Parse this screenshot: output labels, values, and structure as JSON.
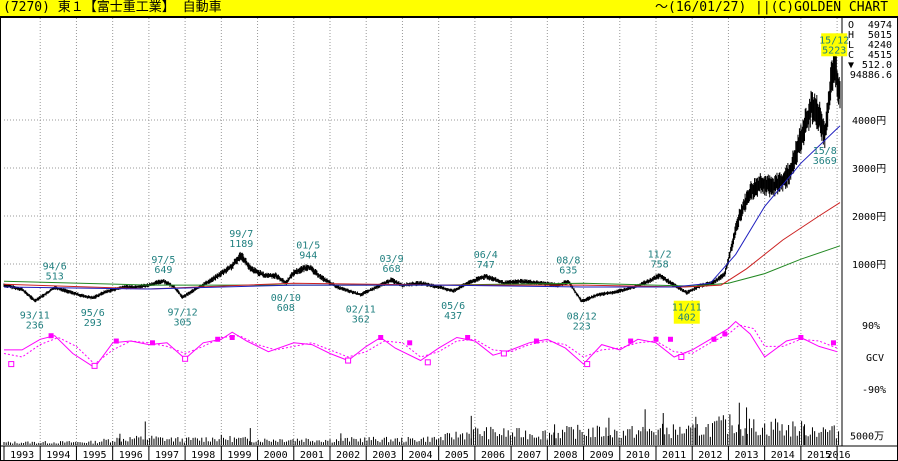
{
  "header": {
    "title": "(7270) 東１【富士重工業】 自動車",
    "date_range": "～(16/01/27)",
    "copyright": "||(C)GOLDEN CHART"
  },
  "colors": {
    "title_bg": "#ffff00",
    "candle": "#000000",
    "ma_short": "#1f1fbf",
    "ma_mid": "#cc2222",
    "ma_long": "#228822",
    "annotation_text": "#1f7f7f",
    "gcv_line": "#ff00ff",
    "gcv_marker": "#ff00ff",
    "volume": "#000000",
    "grid": "#999999",
    "highlight": "#ffff00"
  },
  "chart_data": [
    {
      "type": "line",
      "name": "price",
      "x_start": 1993.0,
      "x_end": 2016.08,
      "ylim": [
        0,
        5500
      ],
      "unit": "円",
      "y_ticks": [
        {
          "value": 1000,
          "label": "1000円"
        },
        {
          "value": 2000,
          "label": "2000円"
        },
        {
          "value": 3000,
          "label": "3000円"
        },
        {
          "value": 4000,
          "label": "4000円"
        }
      ],
      "ohlc_box": [
        {
          "label": "O",
          "value": "4974"
        },
        {
          "label": "H",
          "value": "5015"
        },
        {
          "label": "L",
          "value": "4240"
        },
        {
          "label": "C",
          "value": "4515"
        },
        {
          "label": "▼",
          "value": "512.0"
        },
        {
          "label": "",
          "value": "94886.6"
        }
      ],
      "close_series": [
        [
          1993.0,
          560
        ],
        [
          1993.5,
          470
        ],
        [
          1993.85,
          236
        ],
        [
          1994.2,
          400
        ],
        [
          1994.4,
          513
        ],
        [
          1994.8,
          420
        ],
        [
          1995.2,
          330
        ],
        [
          1995.45,
          293
        ],
        [
          1995.8,
          420
        ],
        [
          1996.3,
          520
        ],
        [
          1996.6,
          520
        ],
        [
          1997.0,
          560
        ],
        [
          1997.4,
          649
        ],
        [
          1997.7,
          520
        ],
        [
          1997.93,
          305
        ],
        [
          1998.3,
          480
        ],
        [
          1998.8,
          700
        ],
        [
          1999.3,
          960
        ],
        [
          1999.55,
          1189
        ],
        [
          1999.8,
          900
        ],
        [
          2000.2,
          760
        ],
        [
          2000.5,
          760
        ],
        [
          2000.78,
          608
        ],
        [
          2001.0,
          820
        ],
        [
          2001.4,
          944
        ],
        [
          2001.8,
          700
        ],
        [
          2002.2,
          520
        ],
        [
          2002.5,
          440
        ],
        [
          2002.85,
          362
        ],
        [
          2003.3,
          520
        ],
        [
          2003.7,
          668
        ],
        [
          2004.0,
          560
        ],
        [
          2004.5,
          600
        ],
        [
          2005.0,
          520
        ],
        [
          2005.4,
          437
        ],
        [
          2005.8,
          600
        ],
        [
          2006.3,
          747
        ],
        [
          2006.8,
          600
        ],
        [
          2007.3,
          640
        ],
        [
          2007.8,
          600
        ],
        [
          2008.3,
          560
        ],
        [
          2008.58,
          635
        ],
        [
          2008.95,
          223
        ],
        [
          2009.4,
          360
        ],
        [
          2009.9,
          420
        ],
        [
          2010.4,
          520
        ],
        [
          2010.8,
          640
        ],
        [
          2011.1,
          758
        ],
        [
          2011.5,
          560
        ],
        [
          2011.85,
          402
        ],
        [
          2012.2,
          540
        ],
        [
          2012.6,
          620
        ],
        [
          2012.9,
          800
        ],
        [
          2013.1,
          1400
        ],
        [
          2013.3,
          2000
        ],
        [
          2013.6,
          2500
        ],
        [
          2013.9,
          2700
        ],
        [
          2014.2,
          2600
        ],
        [
          2014.5,
          2750
        ],
        [
          2014.7,
          2900
        ],
        [
          2014.95,
          3500
        ],
        [
          2015.3,
          4300
        ],
        [
          2015.5,
          4100
        ],
        [
          2015.66,
          3669
        ],
        [
          2015.8,
          4600
        ],
        [
          2015.92,
          5223
        ],
        [
          2016.08,
          4515
        ]
      ],
      "ma_short": [
        [
          1993.0,
          520
        ],
        [
          1997.0,
          480
        ],
        [
          2001.0,
          560
        ],
        [
          2005.0,
          560
        ],
        [
          2009.0,
          520
        ],
        [
          2011.5,
          520
        ],
        [
          2012.5,
          600
        ],
        [
          2013.2,
          1200
        ],
        [
          2014.0,
          2200
        ],
        [
          2015.0,
          3100
        ],
        [
          2016.08,
          3880
        ]
      ],
      "ma_mid": [
        [
          1993.0,
          580
        ],
        [
          1997.0,
          480
        ],
        [
          2001.0,
          600
        ],
        [
          2005.0,
          560
        ],
        [
          2009.0,
          560
        ],
        [
          2011.8,
          520
        ],
        [
          2012.8,
          560
        ],
        [
          2013.5,
          900
        ],
        [
          2014.5,
          1500
        ],
        [
          2015.5,
          2000
        ],
        [
          2016.08,
          2280
        ]
      ],
      "ma_long": [
        [
          1993.0,
          640
        ],
        [
          1997.0,
          560
        ],
        [
          2001.0,
          560
        ],
        [
          2005.0,
          560
        ],
        [
          2009.0,
          600
        ],
        [
          2012.0,
          540
        ],
        [
          2013.0,
          600
        ],
        [
          2014.0,
          800
        ],
        [
          2015.0,
          1100
        ],
        [
          2016.08,
          1380
        ]
      ],
      "annotations": [
        {
          "x": 1993.85,
          "y": 236,
          "period": "93/11",
          "value": "236",
          "pos": "below"
        },
        {
          "x": 1994.4,
          "y": 513,
          "period": "94/6",
          "value": "513",
          "pos": "above"
        },
        {
          "x": 1995.45,
          "y": 293,
          "period": "95/6",
          "value": "293",
          "pos": "below"
        },
        {
          "x": 1997.4,
          "y": 649,
          "period": "97/5",
          "value": "649",
          "pos": "above"
        },
        {
          "x": 1997.93,
          "y": 305,
          "period": "97/12",
          "value": "305",
          "pos": "below"
        },
        {
          "x": 1999.55,
          "y": 1189,
          "period": "99/7",
          "value": "1189",
          "pos": "above"
        },
        {
          "x": 2000.78,
          "y": 608,
          "period": "00/10",
          "value": "608",
          "pos": "below"
        },
        {
          "x": 2001.4,
          "y": 944,
          "period": "01/5",
          "value": "944",
          "pos": "above"
        },
        {
          "x": 2002.85,
          "y": 362,
          "period": "02/11",
          "value": "362",
          "pos": "below"
        },
        {
          "x": 2003.7,
          "y": 668,
          "period": "03/9",
          "value": "668",
          "pos": "above"
        },
        {
          "x": 2005.4,
          "y": 437,
          "period": "05/6",
          "value": "437",
          "pos": "below"
        },
        {
          "x": 2006.3,
          "y": 747,
          "period": "06/4",
          "value": "747",
          "pos": "above"
        },
        {
          "x": 2008.58,
          "y": 635,
          "period": "08/8",
          "value": "635",
          "pos": "above"
        },
        {
          "x": 2008.95,
          "y": 223,
          "period": "08/12",
          "value": "223",
          "pos": "below"
        },
        {
          "x": 2011.1,
          "y": 758,
          "period": "11/2",
          "value": "758",
          "pos": "above"
        },
        {
          "x": 2011.85,
          "y": 402,
          "period": "11/11",
          "value": "402",
          "pos": "below",
          "highlight": true
        },
        {
          "x": 2015.66,
          "y": 3669,
          "period": "15/8",
          "value": "3669",
          "pos": "below"
        },
        {
          "x": 2015.92,
          "y": 5223,
          "period": "15/12",
          "value": "5223",
          "pos": "above",
          "highlight": true
        }
      ]
    },
    {
      "type": "line",
      "name": "GCV",
      "label": "GCV",
      "ylim": [
        -110,
        110
      ],
      "y_ticks": [
        {
          "value": 90,
          "label": "90%"
        },
        {
          "value": -90,
          "label": "-90%"
        }
      ],
      "solid": [
        [
          1993.0,
          20
        ],
        [
          1993.5,
          20
        ],
        [
          1994.0,
          50
        ],
        [
          1994.4,
          60
        ],
        [
          1994.9,
          10
        ],
        [
          1995.5,
          -30
        ],
        [
          1996.0,
          40
        ],
        [
          1996.5,
          45
        ],
        [
          1997.0,
          35
        ],
        [
          1997.5,
          40
        ],
        [
          1998.0,
          -5
        ],
        [
          1998.5,
          40
        ],
        [
          1999.0,
          50
        ],
        [
          1999.3,
          70
        ],
        [
          1999.7,
          45
        ],
        [
          2000.3,
          15
        ],
        [
          2001.0,
          40
        ],
        [
          2001.5,
          35
        ],
        [
          2002.0,
          10
        ],
        [
          2002.5,
          -10
        ],
        [
          2003.0,
          30
        ],
        [
          2003.4,
          55
        ],
        [
          2003.8,
          25
        ],
        [
          2004.5,
          -10
        ],
        [
          2005.0,
          25
        ],
        [
          2005.5,
          55
        ],
        [
          2006.0,
          45
        ],
        [
          2006.5,
          5
        ],
        [
          2007.0,
          20
        ],
        [
          2007.5,
          40
        ],
        [
          2008.0,
          50
        ],
        [
          2008.5,
          25
        ],
        [
          2009.0,
          -20
        ],
        [
          2009.5,
          35
        ],
        [
          2010.0,
          20
        ],
        [
          2010.5,
          50
        ],
        [
          2011.0,
          40
        ],
        [
          2011.5,
          0
        ],
        [
          2012.0,
          20
        ],
        [
          2012.5,
          50
        ],
        [
          2013.0,
          80
        ],
        [
          2013.2,
          100
        ],
        [
          2013.6,
          65
        ],
        [
          2014.0,
          0
        ],
        [
          2014.6,
          45
        ],
        [
          2015.0,
          55
        ],
        [
          2015.5,
          30
        ],
        [
          2016.0,
          15
        ]
      ],
      "dotted": [
        [
          1993.0,
          10
        ],
        [
          1993.5,
          0
        ],
        [
          1994.0,
          35
        ],
        [
          1994.5,
          55
        ],
        [
          1995.0,
          30
        ],
        [
          1995.5,
          -20
        ],
        [
          1996.0,
          20
        ],
        [
          1996.5,
          45
        ],
        [
          1997.0,
          40
        ],
        [
          1997.5,
          30
        ],
        [
          1998.0,
          10
        ],
        [
          1998.5,
          30
        ],
        [
          1999.0,
          55
        ],
        [
          1999.5,
          60
        ],
        [
          2000.0,
          35
        ],
        [
          2000.5,
          20
        ],
        [
          2001.0,
          30
        ],
        [
          2001.5,
          40
        ],
        [
          2002.0,
          20
        ],
        [
          2002.5,
          0
        ],
        [
          2003.0,
          15
        ],
        [
          2003.5,
          45
        ],
        [
          2004.0,
          40
        ],
        [
          2004.5,
          0
        ],
        [
          2005.0,
          15
        ],
        [
          2005.5,
          45
        ],
        [
          2006.0,
          50
        ],
        [
          2006.5,
          20
        ],
        [
          2007.0,
          15
        ],
        [
          2007.5,
          35
        ],
        [
          2008.0,
          45
        ],
        [
          2008.5,
          35
        ],
        [
          2009.0,
          0
        ],
        [
          2009.5,
          20
        ],
        [
          2010.0,
          25
        ],
        [
          2010.5,
          40
        ],
        [
          2011.0,
          45
        ],
        [
          2011.5,
          15
        ],
        [
          2012.0,
          10
        ],
        [
          2012.5,
          40
        ],
        [
          2013.0,
          65
        ],
        [
          2013.3,
          90
        ],
        [
          2013.7,
          80
        ],
        [
          2014.0,
          30
        ],
        [
          2014.5,
          30
        ],
        [
          2015.0,
          50
        ],
        [
          2015.5,
          45
        ],
        [
          2016.0,
          25
        ]
      ],
      "filled_markers": [
        [
          1994.3,
          60
        ],
        [
          1996.1,
          45
        ],
        [
          1997.1,
          40
        ],
        [
          1998.9,
          50
        ],
        [
          1999.3,
          55
        ],
        [
          2003.4,
          55
        ],
        [
          2004.2,
          40
        ],
        [
          2005.8,
          55
        ],
        [
          2007.7,
          45
        ],
        [
          2010.3,
          45
        ],
        [
          2011.0,
          50
        ],
        [
          2011.4,
          50
        ],
        [
          2012.6,
          50
        ],
        [
          2012.9,
          65
        ],
        [
          2015.0,
          55
        ],
        [
          2015.9,
          40
        ]
      ],
      "open_markers": [
        [
          1993.2,
          -20
        ],
        [
          1995.5,
          -25
        ],
        [
          1998.0,
          -5
        ],
        [
          2002.5,
          -10
        ],
        [
          2004.7,
          -15
        ],
        [
          2006.8,
          10
        ],
        [
          2009.1,
          -20
        ],
        [
          2011.7,
          0
        ]
      ]
    },
    {
      "type": "bar",
      "name": "volume",
      "unit": "万",
      "y_ticks": [
        {
          "value": 5000,
          "label": "5000万"
        }
      ],
      "ylim": [
        0,
        25000
      ],
      "x_ticks": [
        "1993",
        "1994",
        "1995",
        "1996",
        "1997",
        "1998",
        "1999",
        "2000",
        "2001",
        "2002",
        "2003",
        "2004",
        "2005",
        "2006",
        "2007",
        "2008",
        "2009",
        "2010",
        "2011",
        "2012",
        "2013",
        "2014",
        "2015",
        "2016"
      ],
      "volume_profile": [
        [
          1993.0,
          1500
        ],
        [
          1995.5,
          1800
        ],
        [
          1996.0,
          3500
        ],
        [
          1997.0,
          4200
        ],
        [
          1998.0,
          3200
        ],
        [
          1999.0,
          4200
        ],
        [
          2000.0,
          3000
        ],
        [
          2001.0,
          3500
        ],
        [
          2002.0,
          3000
        ],
        [
          2003.0,
          3500
        ],
        [
          2004.0,
          3200
        ],
        [
          2005.0,
          4000
        ],
        [
          2006.0,
          8000
        ],
        [
          2007.0,
          7000
        ],
        [
          2008.0,
          7000
        ],
        [
          2009.0,
          8500
        ],
        [
          2010.0,
          7500
        ],
        [
          2011.0,
          9000
        ],
        [
          2012.0,
          8500
        ],
        [
          2013.0,
          13000
        ],
        [
          2014.0,
          10500
        ],
        [
          2015.0,
          10000
        ],
        [
          2016.08,
          8000
        ]
      ],
      "spikes": [
        [
          1996.2,
          6000
        ],
        [
          1996.9,
          12500
        ],
        [
          1999.8,
          9000
        ],
        [
          2002.3,
          6200
        ],
        [
          2005.9,
          15500
        ],
        [
          2008.2,
          11000
        ],
        [
          2009.7,
          14500
        ],
        [
          2010.7,
          19000
        ],
        [
          2011.2,
          17000
        ],
        [
          2012.1,
          15000
        ],
        [
          2013.3,
          22500
        ],
        [
          2013.5,
          20000
        ],
        [
          2014.3,
          14000
        ],
        [
          2015.1,
          11000
        ]
      ]
    }
  ]
}
